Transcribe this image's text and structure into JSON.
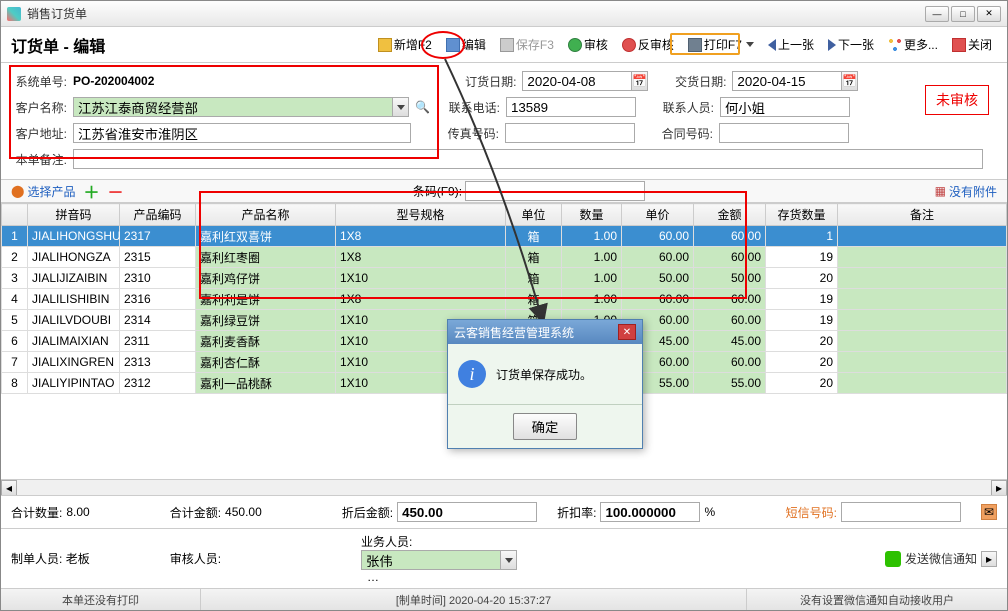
{
  "window": {
    "title": "销售订货单"
  },
  "page": {
    "title": "订货单 - 编辑"
  },
  "toolbar": {
    "new": "新增F2",
    "edit": "编辑",
    "save": "保存F3",
    "audit": "审核",
    "unaudit": "反审核",
    "print": "打印F7",
    "prev": "上一张",
    "next": "下一张",
    "more": "更多...",
    "close": "关闭"
  },
  "form": {
    "sys_no_lbl": "系统单号:",
    "sys_no": "PO-202004002",
    "cust_name_lbl": "客户名称:",
    "cust_name": "江苏江泰商贸经营部",
    "cust_addr_lbl": "客户地址:",
    "cust_addr": "江苏省淮安市淮阴区",
    "remark_lbl": "本单备注:",
    "remark": "",
    "order_date_lbl": "订货日期:",
    "order_date": "2020-04-08",
    "phone_lbl": "联系电话:",
    "phone": "13589",
    "fax_lbl": "传真号码:",
    "fax": "",
    "deliv_date_lbl": "交货日期:",
    "deliv_date": "2020-04-15",
    "contact_lbl": "联系人员:",
    "contact": "何小姐",
    "contract_lbl": "合同号码:",
    "contract": "",
    "status": "未审核"
  },
  "actionbar": {
    "select_product": "选择产品",
    "barcode_lbl": "条码(F9):",
    "no_attach": "没有附件"
  },
  "grid": {
    "headers": [
      "",
      "拼音码",
      "产品编码",
      "产品名称",
      "型号规格",
      "单位",
      "数量",
      "单价",
      "金额",
      "存货数量",
      "备注"
    ],
    "rows": [
      {
        "idx": "1",
        "py": "JIALIHONGSHU",
        "code": "2317",
        "name": "嘉利红双喜饼",
        "spec": "1X8",
        "unit": "箱",
        "qty": "1.00",
        "price": "60.00",
        "amt": "60.00",
        "stock": "1",
        "remark": ""
      },
      {
        "idx": "2",
        "py": "JIALIHONGZA",
        "code": "2315",
        "name": "嘉利红枣圈",
        "spec": "1X8",
        "unit": "箱",
        "qty": "1.00",
        "price": "60.00",
        "amt": "60.00",
        "stock": "19",
        "remark": ""
      },
      {
        "idx": "3",
        "py": "JIALIJIZAIBIN",
        "code": "2310",
        "name": "嘉利鸡仔饼",
        "spec": "1X10",
        "unit": "箱",
        "qty": "1.00",
        "price": "50.00",
        "amt": "50.00",
        "stock": "20",
        "remark": ""
      },
      {
        "idx": "4",
        "py": "JIALILISHIBIN",
        "code": "2316",
        "name": "嘉利利是饼",
        "spec": "1X8",
        "unit": "箱",
        "qty": "1.00",
        "price": "60.00",
        "amt": "60.00",
        "stock": "19",
        "remark": ""
      },
      {
        "idx": "5",
        "py": "JIALILVDOUBI",
        "code": "2314",
        "name": "嘉利绿豆饼",
        "spec": "1X10",
        "unit": "箱",
        "qty": "1.00",
        "price": "60.00",
        "amt": "60.00",
        "stock": "19",
        "remark": ""
      },
      {
        "idx": "6",
        "py": "JIALIMAIXIAN",
        "code": "2311",
        "name": "嘉利麦香酥",
        "spec": "1X10",
        "unit": "",
        "qty": "",
        "price": "45.00",
        "amt": "45.00",
        "stock": "20",
        "remark": ""
      },
      {
        "idx": "7",
        "py": "JIALIXINGREN",
        "code": "2313",
        "name": "嘉利杏仁酥",
        "spec": "1X10",
        "unit": "",
        "qty": "",
        "price": "60.00",
        "amt": "60.00",
        "stock": "20",
        "remark": ""
      },
      {
        "idx": "8",
        "py": "JIALIYIPINTAO",
        "code": "2312",
        "name": "嘉利一品桃酥",
        "spec": "1X10",
        "unit": "",
        "qty": "",
        "price": "55.00",
        "amt": "55.00",
        "stock": "20",
        "remark": ""
      }
    ]
  },
  "summary": {
    "total_qty_lbl": "合计数量:",
    "total_qty": "8.00",
    "total_amt_lbl": "合计金额:",
    "total_amt": "450.00",
    "disc_amt_lbl": "折后金额:",
    "disc_amt": "450.00",
    "disc_rate_lbl": "折扣率:",
    "disc_rate": "100.000000",
    "pct": "%",
    "sms_lbl": "短信号码:"
  },
  "bottom": {
    "maker_lbl": "制单人员:",
    "maker": "老板",
    "auditor_lbl": "审核人员:",
    "auditor": "",
    "sales_lbl": "业务人员:",
    "sales": "张伟",
    "wechat": "发送微信通知"
  },
  "statusbar": {
    "left": "本单还没有打印",
    "center": "[制单时间] 2020-04-20 15:37:27",
    "right": "没有设置微信通知自动接收用户"
  },
  "dialog": {
    "title": "云客销售经营管理系统",
    "msg": "订货单保存成功。",
    "ok": "确定"
  }
}
